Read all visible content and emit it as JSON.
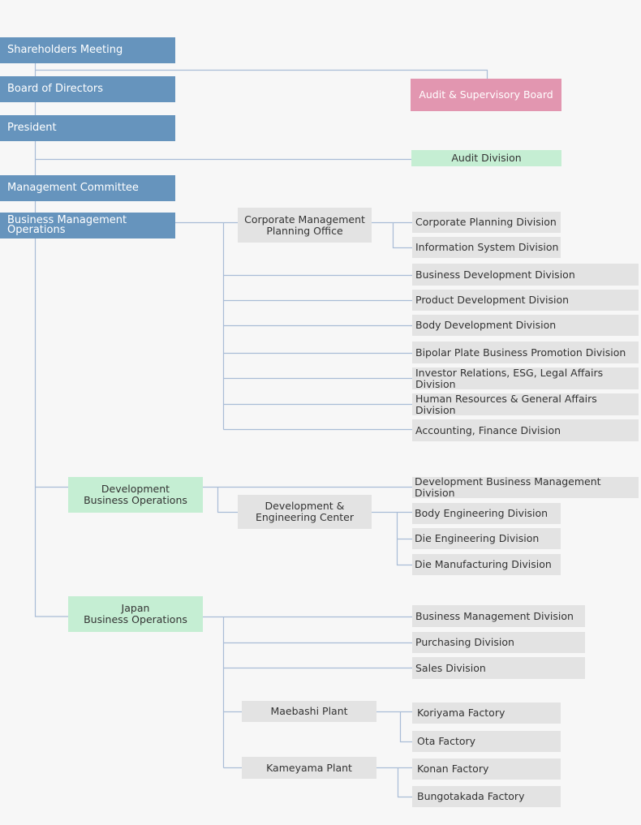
{
  "colors": {
    "executive": "#6694bd",
    "audit_board": "#e296b0",
    "operations": "#c5eed3",
    "unit": "#e3e3e3",
    "connector": "#a9bcd6"
  },
  "top": {
    "shareholders": "Shareholders Meeting",
    "board": "Board of Directors",
    "president": "President",
    "committee": "Management Committee",
    "bmo": "Business Management\nOperations",
    "audit_board": "Audit & Supervisory Board",
    "audit_division": "Audit Division"
  },
  "bmo": {
    "office": "Corporate Management\nPlanning Office",
    "office_divisions": [
      "Corporate Planning Division",
      "Information System Division"
    ],
    "divisions": [
      "Business Development Division",
      "Product Development Division",
      "Body Development Division",
      "Bipolar Plate Business Promotion Division",
      "Investor Relations, ESG, Legal Affairs Division",
      "Human Resources & General Affairs Division",
      "Accounting, Finance Division"
    ]
  },
  "dev": {
    "title": "Development\nBusiness Operations",
    "division": "Development Business Management Division",
    "center": "Development &\nEngineering Center",
    "center_divisions": [
      "Body Engineering Division",
      "Die Engineering Division",
      "Die Manufacturing Division"
    ]
  },
  "japan": {
    "title": "Japan\nBusiness Operations",
    "divisions": [
      "Business Management Division",
      "Purchasing Division",
      "Sales Division"
    ],
    "plants": [
      {
        "name": "Maebashi Plant",
        "factories": [
          "Koriyama Factory",
          "Ota Factory"
        ]
      },
      {
        "name": "Kameyama Plant",
        "factories": [
          "Konan Factory",
          "Bungotakada Factory"
        ]
      }
    ]
  }
}
